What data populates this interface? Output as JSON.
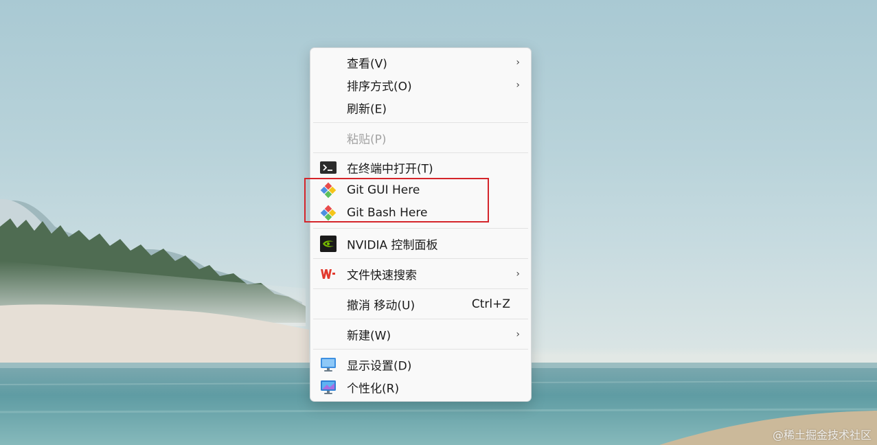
{
  "menu": {
    "items": [
      {
        "label": "查看(V)",
        "has_submenu": true
      },
      {
        "label": "排序方式(O)",
        "has_submenu": true
      },
      {
        "label": "刷新(E)"
      },
      {
        "label": "粘贴(P)",
        "disabled": true
      },
      {
        "label": "在终端中打开(T)",
        "icon": "terminal-icon"
      },
      {
        "label": "Git GUI Here",
        "icon": "git-icon"
      },
      {
        "label": "Git Bash Here",
        "icon": "git-icon"
      },
      {
        "label": "NVIDIA 控制面板",
        "icon": "nvidia-icon"
      },
      {
        "label": "文件快速搜索",
        "icon": "wps-icon",
        "has_submenu": true
      },
      {
        "label": "撤消 移动(U)",
        "shortcut": "Ctrl+Z"
      },
      {
        "label": "新建(W)",
        "has_submenu": true
      },
      {
        "label": "显示设置(D)",
        "icon": "display-settings-icon"
      },
      {
        "label": "个性化(R)",
        "icon": "personalize-icon"
      }
    ],
    "chevron": "›"
  },
  "highlight_color": "#d4242a",
  "watermark": "@稀土掘金技术社区"
}
